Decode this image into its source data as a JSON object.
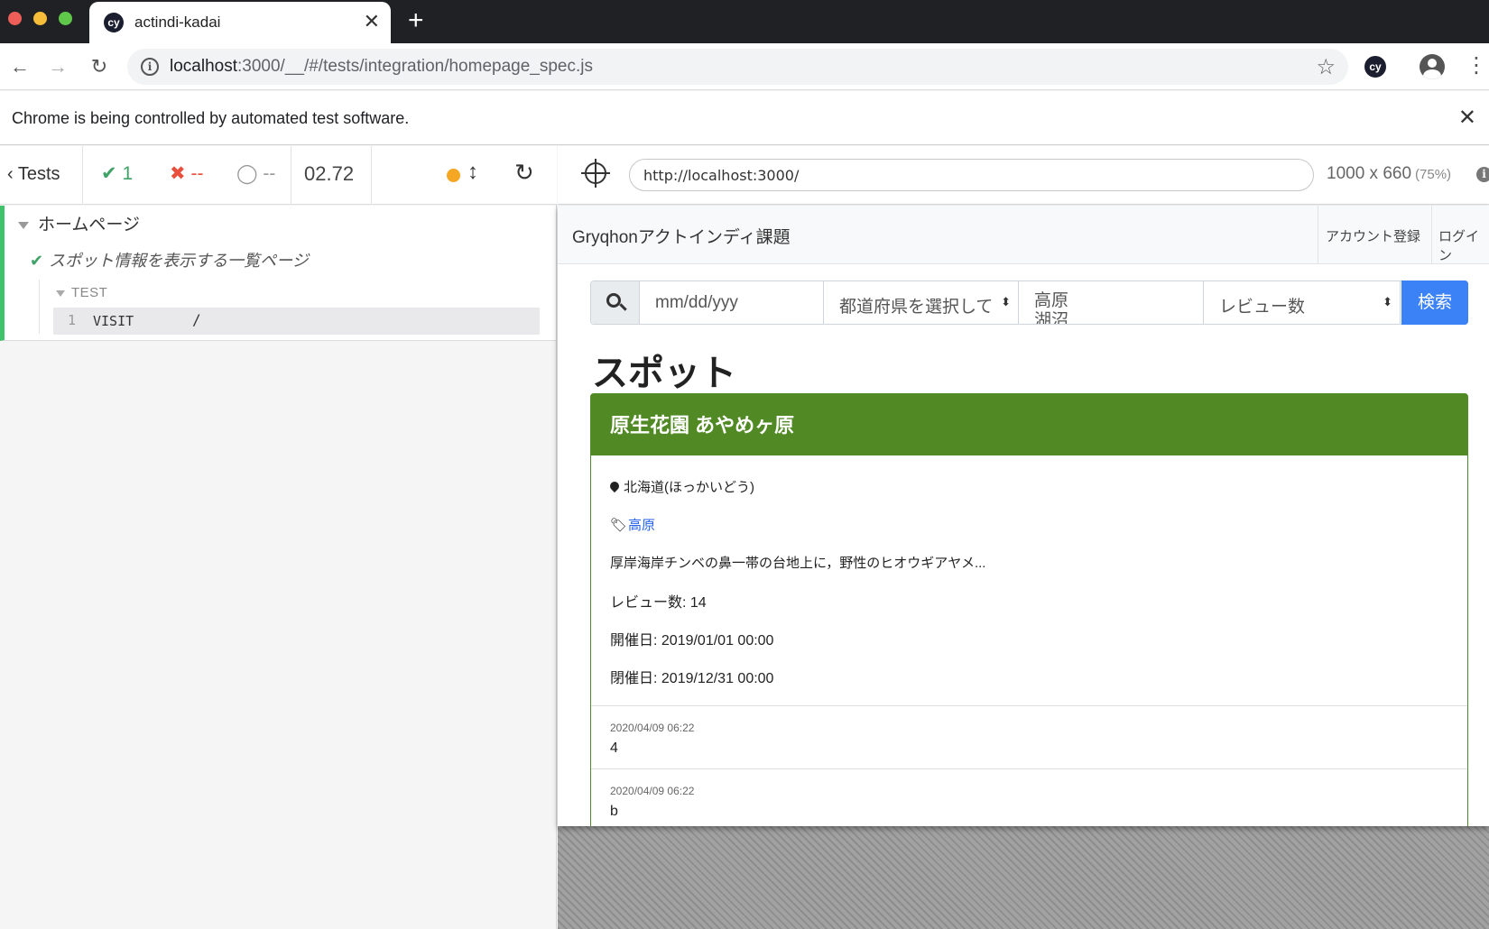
{
  "browser": {
    "tab_title": "actindi-kadai",
    "tab_favicon": "cy",
    "url_host": "localhost",
    "url_rest": ":3000/__/#/tests/integration/homepage_spec.js",
    "extension_label": "cy",
    "infobar_text": "Chrome is being controlled by automated test software."
  },
  "reporter": {
    "tests_label": "Tests",
    "passed": "1",
    "failed": "--",
    "pending": "--",
    "duration": "02.72",
    "suite_title": "ホームページ",
    "test_title": "スポット情報を表示する一覧ページ",
    "test_section_label": "TEST",
    "commands": [
      {
        "number": "1",
        "name": "VISIT",
        "message": "/"
      }
    ]
  },
  "runner": {
    "aut_url": "http://localhost:3000/",
    "viewport_size": "1000 x 660",
    "viewport_scale": "(75%)"
  },
  "app": {
    "brand": "Gryqhonアクトインディ課題",
    "nav_links": [
      "アカウント登録",
      "ログイン"
    ],
    "search": {
      "date_placeholder": "mm/dd/yyy",
      "prefecture_select": "都道府県を選択して",
      "area_text": "高原\n湖沼",
      "sort_select": "レビュー数",
      "button": "検索"
    },
    "heading": "スポット",
    "spot": {
      "name": "原生花園 あやめヶ原",
      "location": "北海道(ほっかいどう)",
      "tag": "高原",
      "description": "厚岸海岸チンベの鼻一帯の台地上に，野性のヒオウギアヤメ...",
      "review_count": "レビュー数: 14",
      "start_date": "開催日: 2019/01/01 00:00",
      "end_date": "閉催日: 2019/12/31 00:00",
      "header_color": "#518a25",
      "reviews": [
        {
          "date": "2020/04/09 06:22",
          "text": "4"
        },
        {
          "date": "2020/04/09 06:22",
          "text": "b"
        }
      ]
    }
  },
  "colors": {
    "pass_green": "#3fa267",
    "fail_red": "#e94f3d",
    "running_orange": "#f5a623",
    "primary_blue": "#3b82f6"
  }
}
